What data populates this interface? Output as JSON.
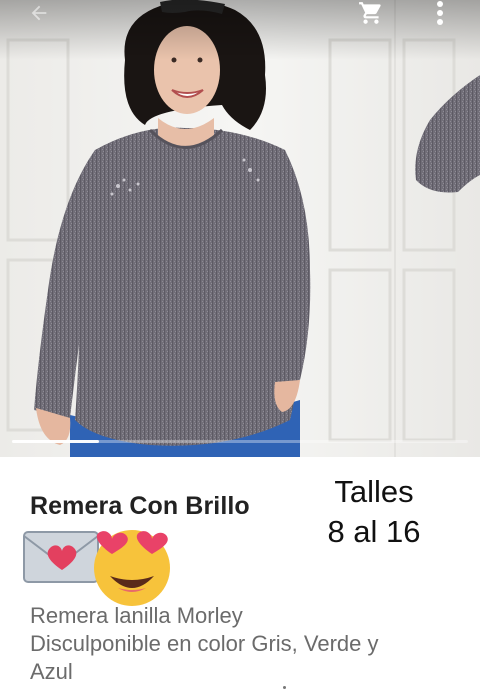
{
  "product": {
    "title": "Remera Con Brillo",
    "sizes_line1": "Talles",
    "sizes_line2": "8 al 16",
    "description": [
      "Remera lanilla Morley",
      "Disculponible en color Gris, Verde y",
      "Azul"
    ],
    "emojis": [
      "love-letter-icon",
      "heart-eyes-face-icon"
    ]
  },
  "gallery": {
    "image_progress": 0.19,
    "icons": [
      "back-arrow-icon",
      "cart-icon",
      "more-vert-icon"
    ]
  },
  "colors": {
    "title": "#222222",
    "description": "#6b6b6b",
    "sweater": "#6f6c75",
    "jeans": "#2f63b5"
  }
}
